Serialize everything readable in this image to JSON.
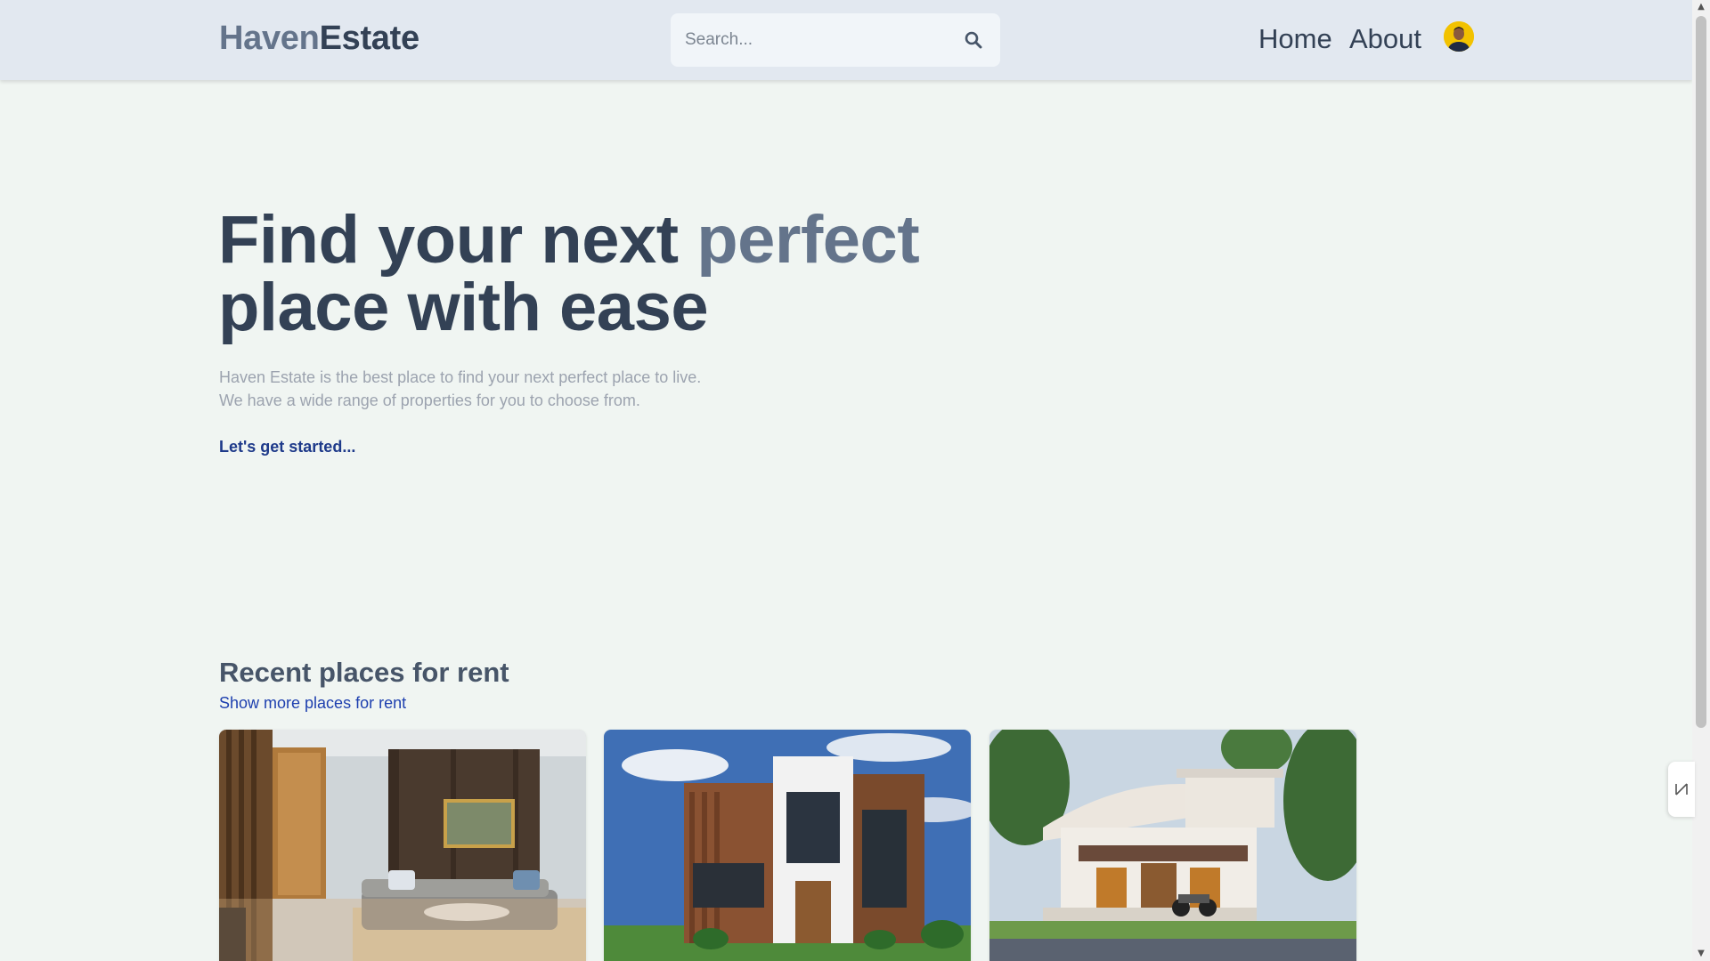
{
  "header": {
    "logo_part1": "Haven",
    "logo_part2": "Estate",
    "search_placeholder": "Search...",
    "nav": {
      "home": "Home",
      "about": "About"
    }
  },
  "hero": {
    "title_line1_a": "Find your next ",
    "title_line1_b": "perfect",
    "title_line2": "place with ease",
    "desc_line1": "Haven Estate is the best place to find your next perfect place to live.",
    "desc_line2": "We have a wide range of properties for you to choose from.",
    "cta": "Let's get started..."
  },
  "recent": {
    "title": "Recent places for rent",
    "link": "Show more places for rent",
    "cards": [
      {
        "image": "living-room-interior"
      },
      {
        "image": "modern-two-story-house"
      },
      {
        "image": "white-villa-with-motorcycle"
      }
    ]
  },
  "colors": {
    "header_bg": "#e2e8f0",
    "page_bg": "#f0f5f2",
    "logo_light": "#64748b",
    "logo_dark": "#334155",
    "cta": "#1e3a8a",
    "link": "#1e40af"
  }
}
